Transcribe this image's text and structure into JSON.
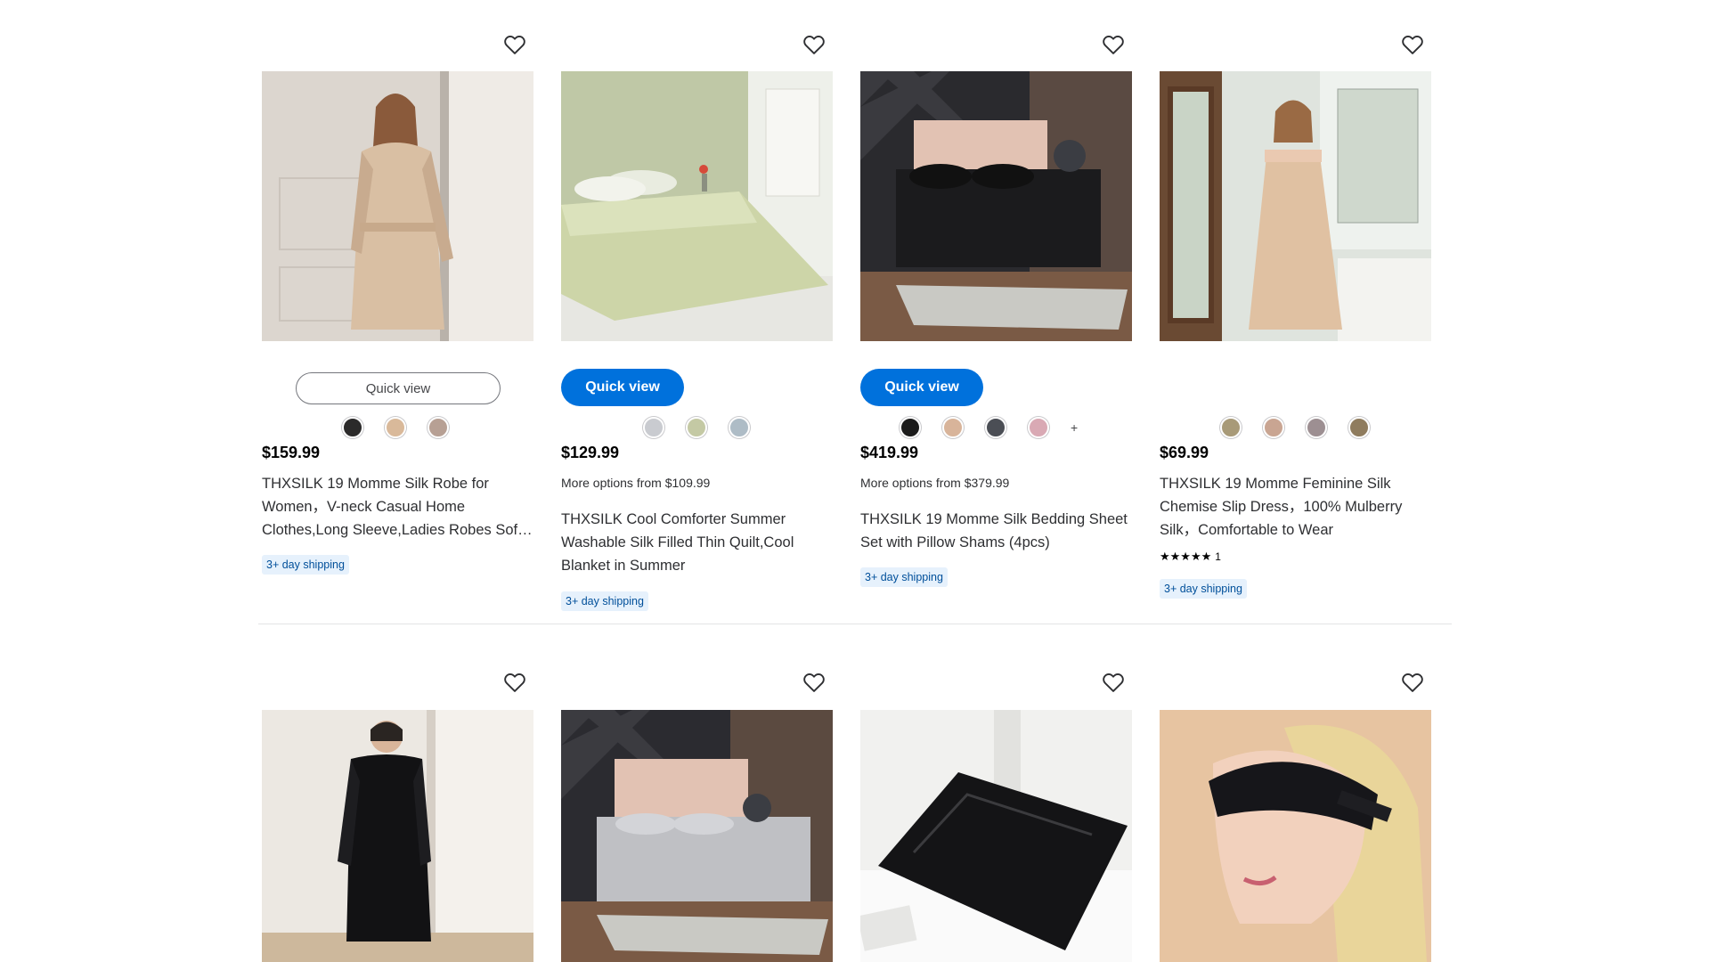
{
  "colors": {
    "accent": "#0071dc",
    "shipping_bg": "#e6f1fc",
    "shipping_text": "#004f9a"
  },
  "icons": {
    "favorite": "heart-outline-icon"
  },
  "row1": [
    {
      "quick_view": "Quick view",
      "quick_view_style": "outline",
      "swatches": [
        "#2b2a2a",
        "#d9b99a",
        "#b7a094"
      ],
      "price": "$159.99",
      "more_options": "",
      "title": "THXSILK 19 Momme Silk Robe for Women，V-neck Casual Home Clothes,Long Sleeve,Ladies Robes Soft and Comfortable",
      "shipping": "3+ day shipping"
    },
    {
      "quick_view": "Quick view",
      "quick_view_style": "solid",
      "swatches": [
        "#c9cbd0",
        "#c4c9a4",
        "#aebcc6"
      ],
      "price": "$129.99",
      "more_options": "More options from $109.99",
      "title": "THXSILK Cool Comforter Summer Washable Silk Filled Thin Quilt,Cool Blanket in Summer",
      "shipping": "3+ day shipping"
    },
    {
      "quick_view": "Quick view",
      "quick_view_style": "solid",
      "swatches": [
        "#1b1b1b",
        "#d8b49a",
        "#4b4e55",
        "#d9a9b4"
      ],
      "swatch_more": "+",
      "price": "$419.99",
      "more_options": "More options from $379.99",
      "title": "THXSILK 19 Momme Silk Bedding Sheet Set with Pillow Shams (4pcs)",
      "shipping": "3+ day shipping"
    },
    {
      "quick_view": "",
      "quick_view_style": "none",
      "swatches": [
        "#a89a78",
        "#c9a592",
        "#9d8f92",
        "#8f7c5e"
      ],
      "price": "$69.99",
      "more_options": "",
      "title": "THXSILK 19 Momme Feminine Silk Chemise Slip Dress，100% Mulberry Silk，Comfortable to Wear",
      "rating_stars": "★★★★★",
      "rating_value": 5,
      "rating_count": "1",
      "shipping": "3+ day shipping"
    }
  ]
}
